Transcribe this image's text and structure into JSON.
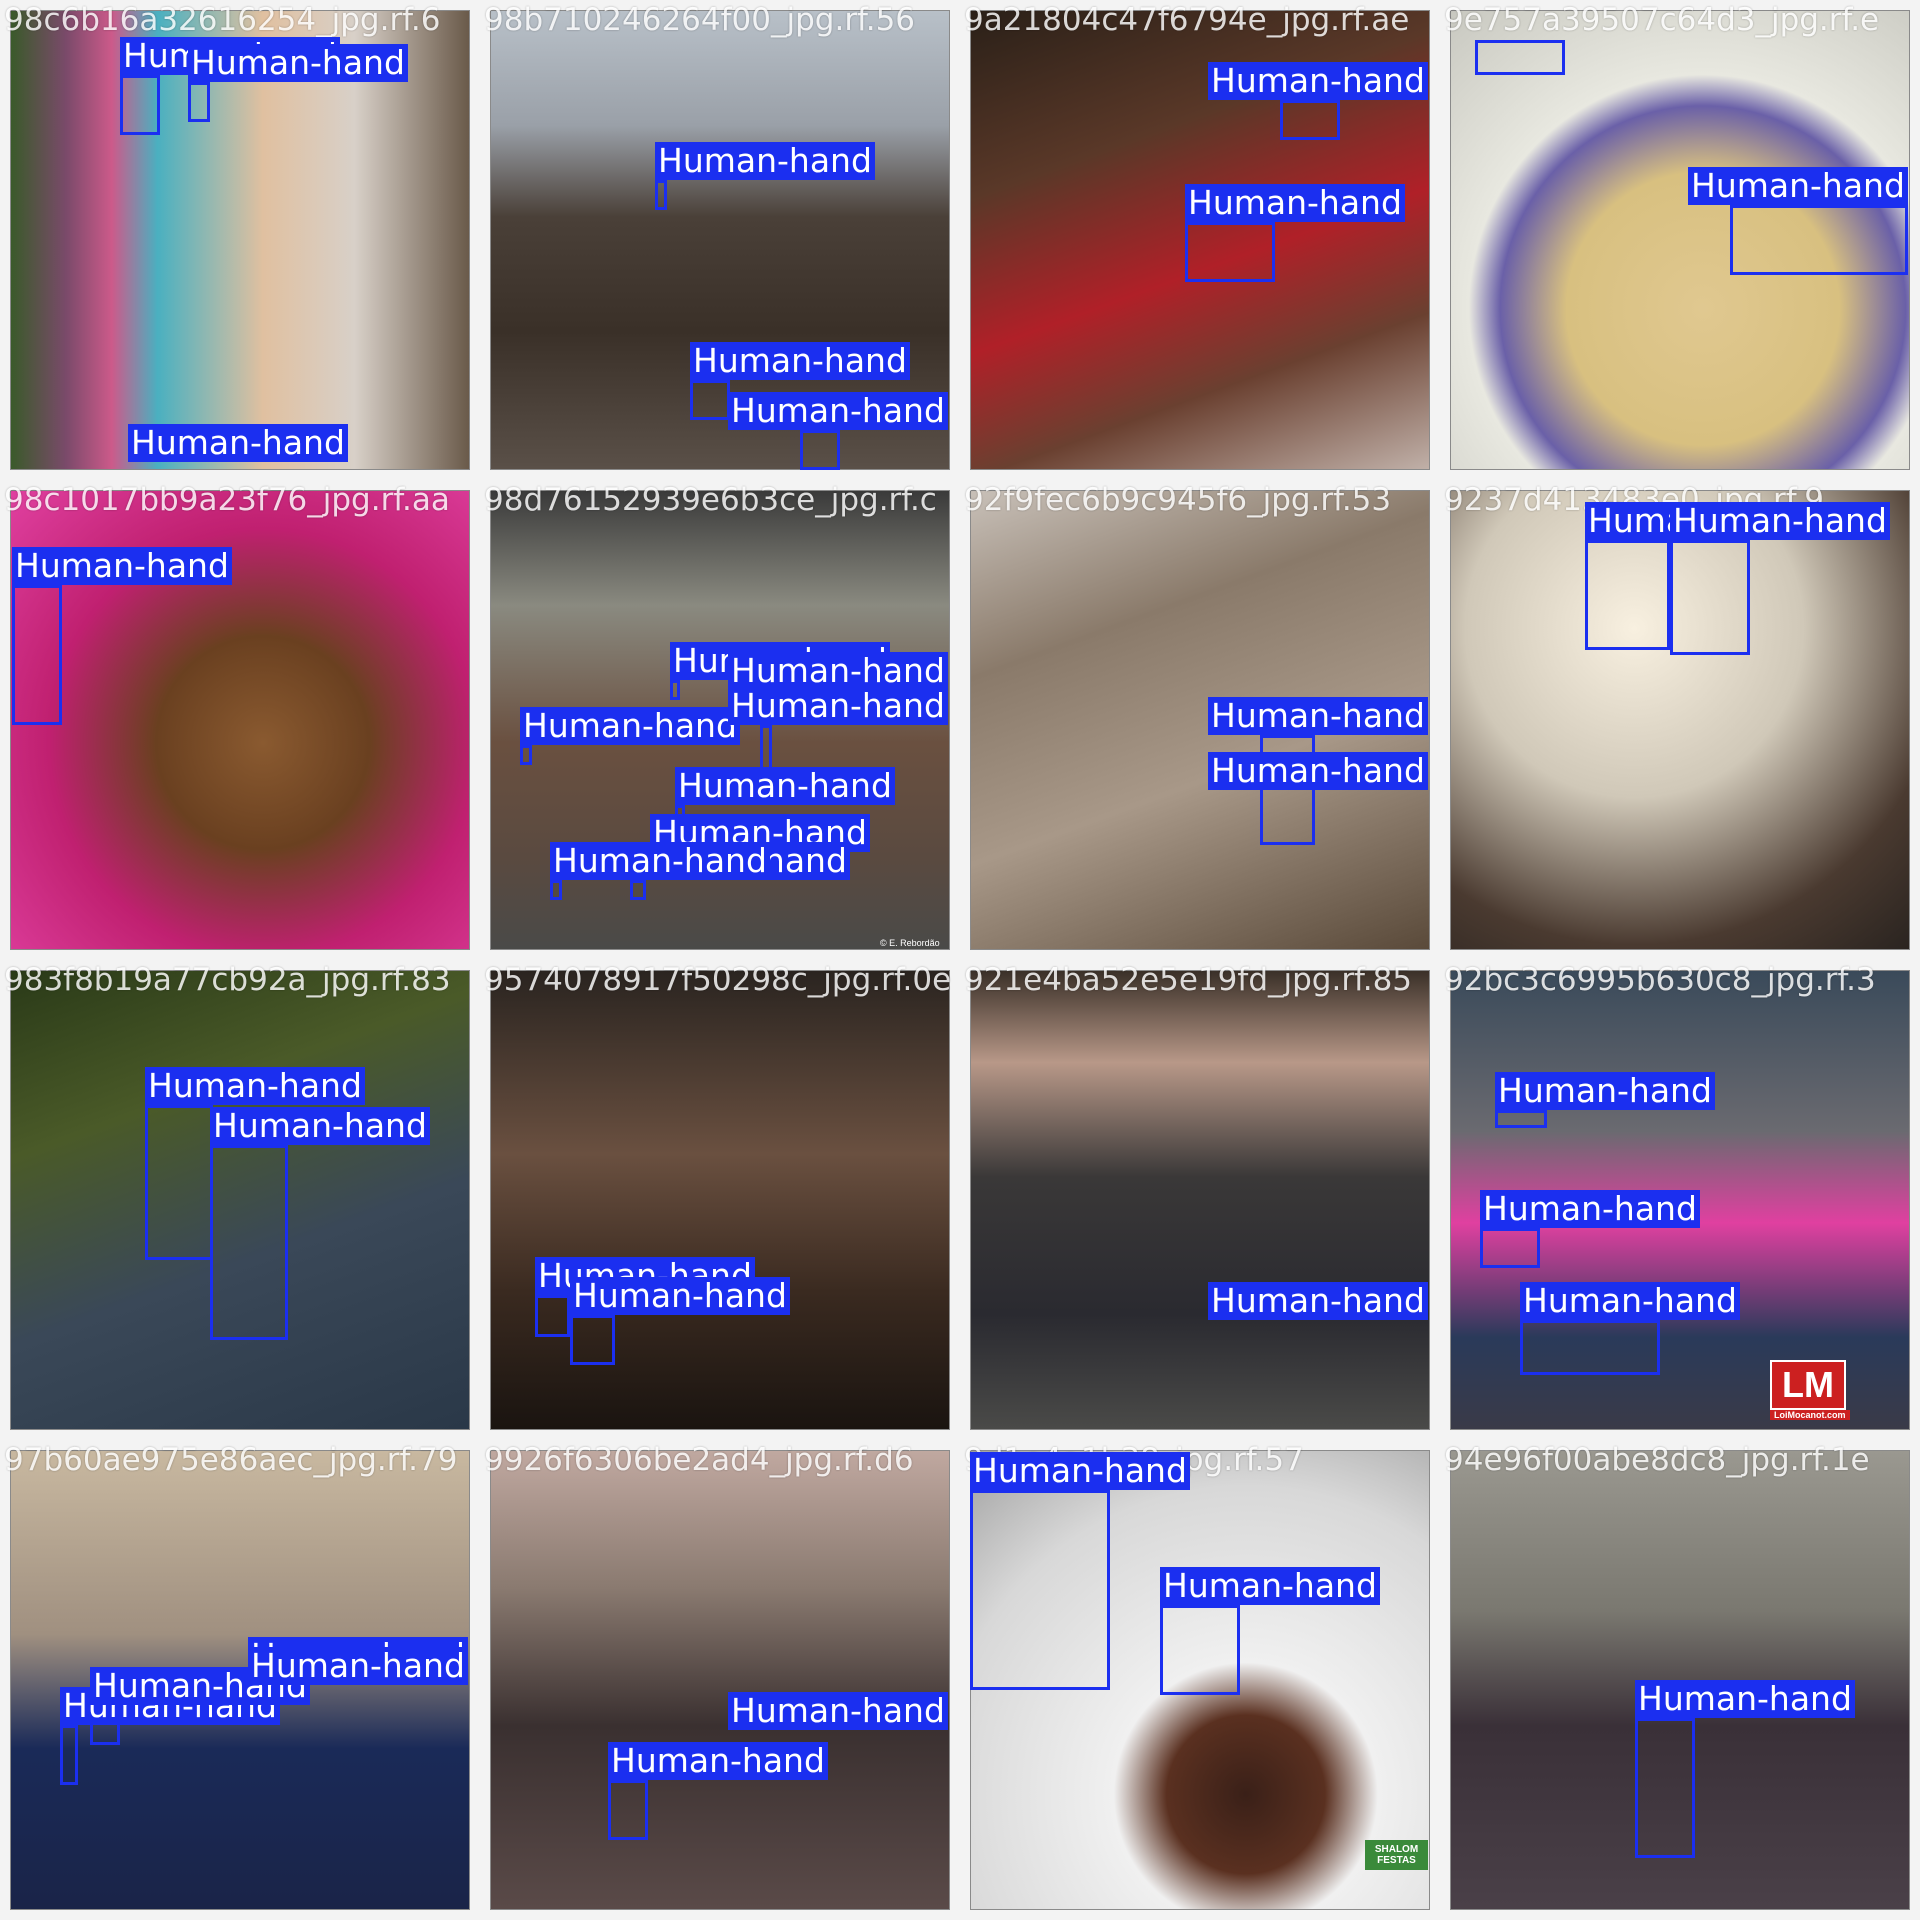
{
  "colors": {
    "box": "#1b2ff0",
    "label_text": "#ffffff",
    "grid_bg": "#7f7f7f"
  },
  "tiles": [
    {
      "filename": "98c6b16a32616254_jpg.rf.6",
      "label": "Human-hand"
    },
    {
      "filename": "98b710246264f00_jpg.rf.56",
      "label": "Human-hand"
    },
    {
      "filename": "9a21804c47f6794e_jpg.rf.ae",
      "label": "Human-hand"
    },
    {
      "filename": "9e757a39507c64d3_jpg.rf.e",
      "label": "Human-hand"
    },
    {
      "filename": "98c1017bb9a23f76_jpg.rf.aa",
      "label": "Human-hand"
    },
    {
      "filename": "98d76152939e6b3ce_jpg.rf.c",
      "label": "Human-hand"
    },
    {
      "filename": "92f9fec6b9c945f6_jpg.rf.53",
      "label": "Human-hand"
    },
    {
      "filename": "9237d413483e0_jpg.rf.9",
      "label": "Human-hand"
    },
    {
      "filename": "983f8b19a77cb92a_jpg.rf.83",
      "label": "Human-hand"
    },
    {
      "filename": "9574078917f50298c_jpg.rf.0e",
      "label": "Human-hand"
    },
    {
      "filename": "921e4ba52e5e19fd_jpg.rf.85",
      "label": "Human-hand"
    },
    {
      "filename": "92bc3c6995b630c8_jpg.rf.3",
      "label": "Human-hand"
    },
    {
      "filename": "97b60ae975e86aec_jpg.rf.79",
      "label": "Human-hand"
    },
    {
      "filename": "9926f6306be2ad4_jpg.rf.d6",
      "label": "Human-hand"
    },
    {
      "filename": "9d1e4a1b38_jpg.rf.57",
      "label": "Human-hand"
    },
    {
      "filename": "94e96f00abe8dc8_jpg.rf.1e",
      "label": "Human-hand"
    }
  ],
  "logos": {
    "lm": "LM",
    "lm_sub": "LoiMocanot.com",
    "shalom": "SHALOM FESTAS",
    "credit": "© E. Rebordão"
  }
}
